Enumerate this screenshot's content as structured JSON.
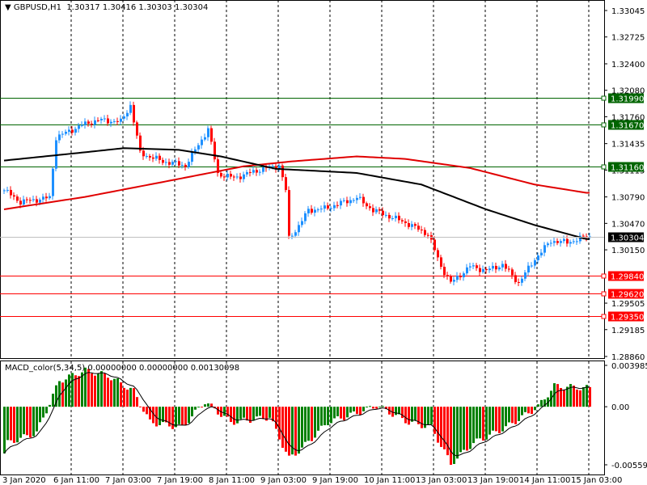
{
  "header": {
    "symbol": "GBPUSD,H1",
    "open": "1.30317",
    "high": "1.30416",
    "low": "1.30303",
    "close": "1.30304"
  },
  "macd_header": {
    "name": "MACD_color(5,34,5)",
    "v1": "0.00000000",
    "v2": "0.00000000",
    "v3": "0.00130098"
  },
  "chart_data": {
    "type": "candlestick",
    "price_ticks": [
      "1.33045",
      "1.32725",
      "1.32400",
      "1.32080",
      "1.31760",
      "1.31435",
      "1.31115",
      "1.30790",
      "1.30470",
      "1.30150",
      "1.29505",
      "1.29185",
      "1.28860"
    ],
    "ylim": [
      1.2886,
      1.33045
    ],
    "current_price": "1.30304",
    "levels": [
      {
        "price": "1.31990",
        "color": "#006400"
      },
      {
        "price": "1.31670",
        "color": "#006400"
      },
      {
        "price": "1.31160",
        "color": "#006400"
      },
      {
        "price": "1.29840",
        "color": "#ff0000"
      },
      {
        "price": "1.29620",
        "color": "#ff0000"
      },
      {
        "price": "1.29350",
        "color": "#ff0000"
      }
    ],
    "time_labels": [
      "3 Jan 2020",
      "6 Jan 11:00",
      "7 Jan 03:00",
      "7 Jan 19:00",
      "8 Jan 11:00",
      "9 Jan 03:00",
      "9 Jan 19:00",
      "10 Jan 11:00",
      "13 Jan 03:00",
      "13 Jan 19:00",
      "14 Jan 11:00",
      "15 Jan 03:00"
    ],
    "bars": 182,
    "close_path": [
      [
        0,
        1.3087
      ],
      [
        5,
        1.3073
      ],
      [
        14,
        1.3078
      ],
      [
        16,
        1.3151
      ],
      [
        24,
        1.3166
      ],
      [
        29,
        1.3172
      ],
      [
        36,
        1.317
      ],
      [
        39,
        1.319
      ],
      [
        42,
        1.3132
      ],
      [
        49,
        1.3122
      ],
      [
        56,
        1.3117
      ],
      [
        63,
        1.3161
      ],
      [
        66,
        1.3107
      ],
      [
        71,
        1.3102
      ],
      [
        79,
        1.3112
      ],
      [
        85,
        1.3117
      ],
      [
        87,
        1.3087
      ],
      [
        88,
        1.3029
      ],
      [
        91,
        1.3044
      ],
      [
        94,
        1.3063
      ],
      [
        99,
        1.3065
      ],
      [
        109,
        1.3078
      ],
      [
        114,
        1.3063
      ],
      [
        124,
        1.3048
      ],
      [
        131,
        1.3034
      ],
      [
        135,
        1.2995
      ],
      [
        138,
        1.2975
      ],
      [
        144,
        1.2995
      ],
      [
        149,
        1.299
      ],
      [
        154,
        1.2997
      ],
      [
        159,
        1.2975
      ],
      [
        164,
        1.3004
      ],
      [
        169,
        1.3026
      ],
      [
        174,
        1.3024
      ],
      [
        180,
        1.3031
      ]
    ],
    "ma_fast_path": [
      [
        0,
        1.3123
      ],
      [
        25,
        1.3133
      ],
      [
        37,
        1.3138
      ],
      [
        54,
        1.3136
      ],
      [
        67,
        1.3128
      ],
      [
        84,
        1.3113
      ],
      [
        109,
        1.3108
      ],
      [
        129,
        1.3094
      ],
      [
        149,
        1.3064
      ],
      [
        164,
        1.3045
      ],
      [
        180,
        1.3028
      ]
    ],
    "ma_slow_path": [
      [
        0,
        1.3064
      ],
      [
        25,
        1.3079
      ],
      [
        49,
        1.3097
      ],
      [
        74,
        1.3116
      ],
      [
        89,
        1.3122
      ],
      [
        109,
        1.3128
      ],
      [
        124,
        1.3125
      ],
      [
        144,
        1.3114
      ],
      [
        164,
        1.3094
      ],
      [
        180,
        1.3084
      ]
    ],
    "macd": {
      "ylim": [
        -0.005594,
        0.0039857
      ],
      "ticks": [
        "0.0039857",
        "0.00",
        "-0.005594"
      ],
      "hist_path": [
        [
          0,
          -0.0045
        ],
        [
          1,
          -0.0035
        ],
        [
          10,
          -0.0025
        ],
        [
          17,
          0.0025
        ],
        [
          25,
          0.0035
        ],
        [
          32,
          0.003
        ],
        [
          40,
          0.0015
        ],
        [
          45,
          -0.0015
        ],
        [
          55,
          -0.002
        ],
        [
          62,
          0.0005
        ],
        [
          70,
          -0.0015
        ],
        [
          82,
          -0.001
        ],
        [
          88,
          -0.005
        ],
        [
          92,
          -0.004
        ],
        [
          100,
          -0.0015
        ],
        [
          110,
          -0.0005
        ],
        [
          115,
          0.0001
        ],
        [
          125,
          -0.0015
        ],
        [
          132,
          -0.002
        ],
        [
          138,
          -0.0055
        ],
        [
          145,
          -0.0035
        ],
        [
          155,
          -0.002
        ],
        [
          165,
          0.0
        ],
        [
          170,
          0.002
        ],
        [
          180,
          0.0018
        ]
      ]
    }
  }
}
